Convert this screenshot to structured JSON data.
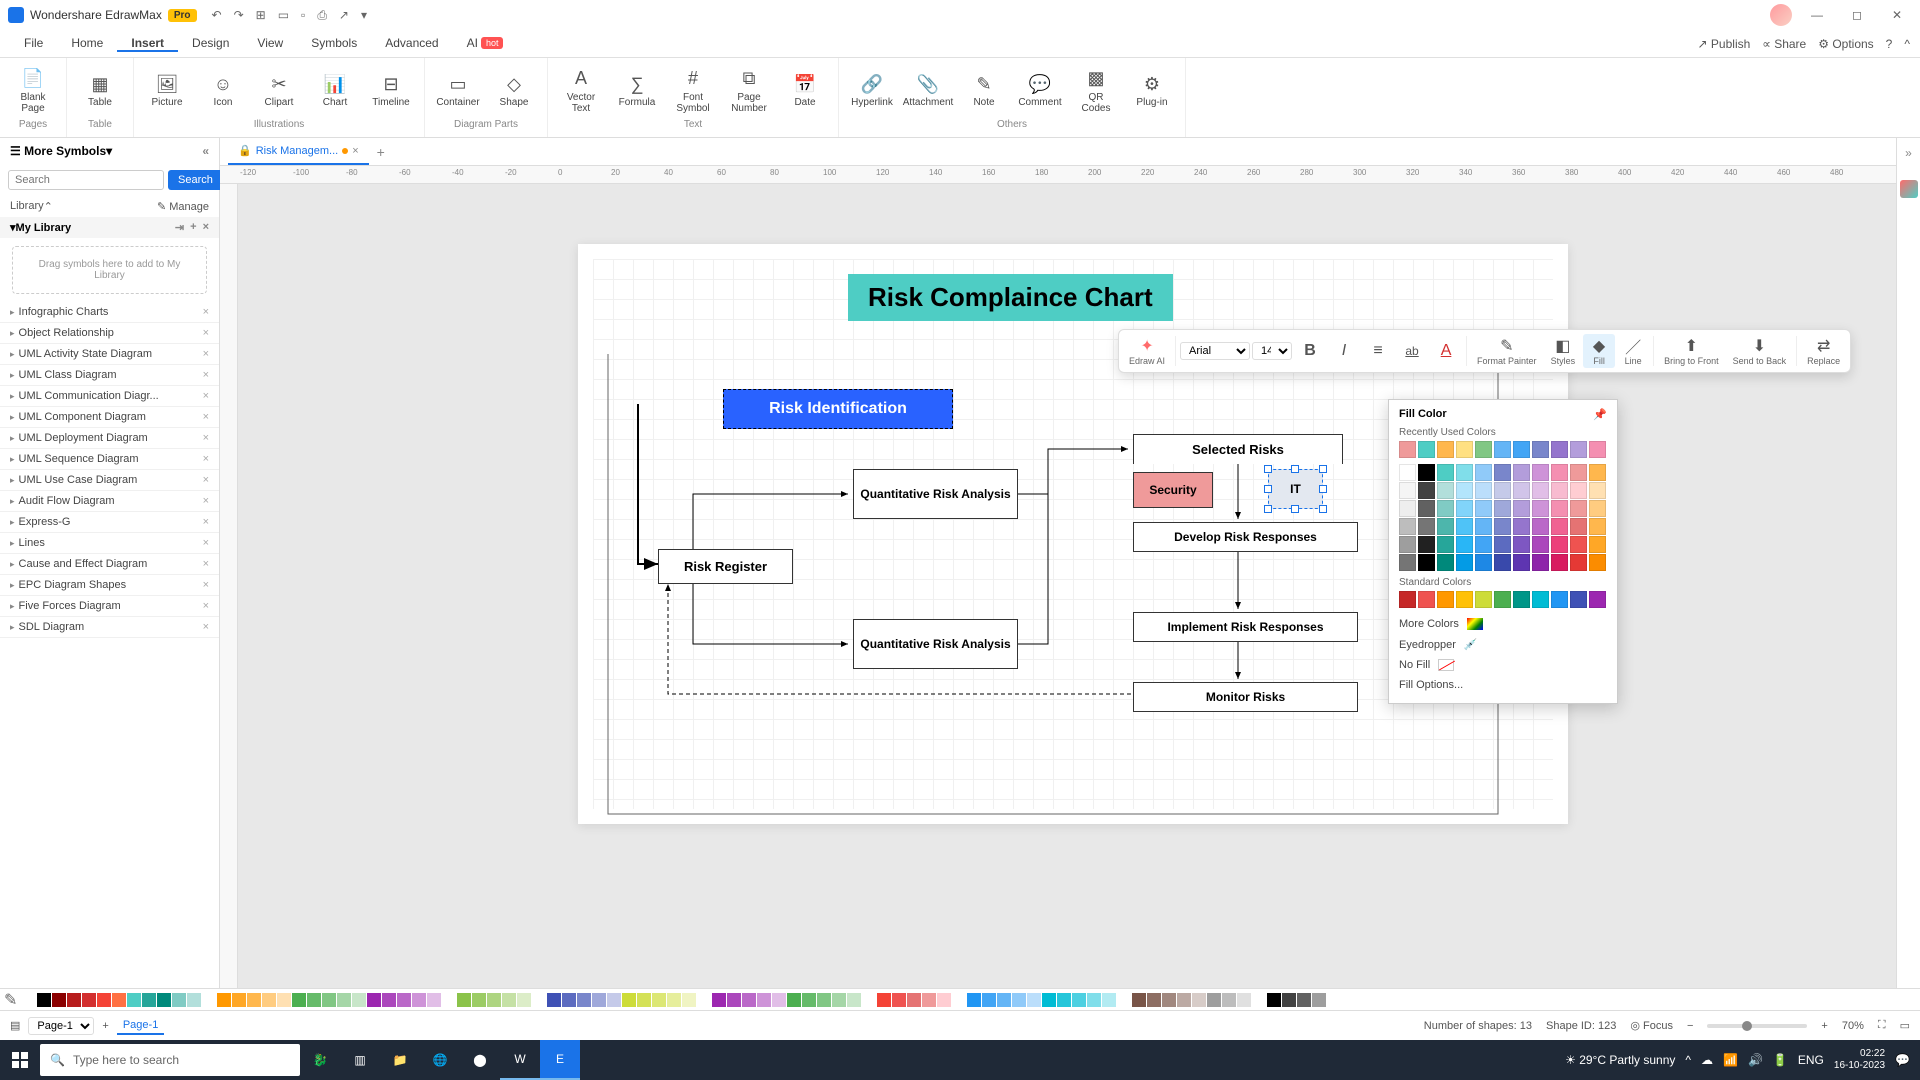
{
  "titlebar": {
    "app_name": "Wondershare EdrawMax",
    "pro_badge": "Pro"
  },
  "menubar": {
    "tabs": [
      "File",
      "Home",
      "Insert",
      "Design",
      "View",
      "Symbols",
      "Advanced",
      "AI"
    ],
    "active": "Insert",
    "ai_hot": "hot",
    "right": {
      "publish": "Publish",
      "share": "Share",
      "options": "Options"
    }
  },
  "ribbon": {
    "groups": [
      {
        "label": "Pages",
        "items": [
          {
            "label": "Blank\nPage",
            "icon": "📄"
          }
        ]
      },
      {
        "label": "Table",
        "items": [
          {
            "label": "Table",
            "icon": "▦"
          }
        ]
      },
      {
        "label": "Illustrations",
        "items": [
          {
            "label": "Picture",
            "icon": "🖼"
          },
          {
            "label": "Icon",
            "icon": "☺"
          },
          {
            "label": "Clipart",
            "icon": "✂"
          },
          {
            "label": "Chart",
            "icon": "📊"
          },
          {
            "label": "Timeline",
            "icon": "⊟"
          }
        ]
      },
      {
        "label": "Diagram Parts",
        "items": [
          {
            "label": "Container",
            "icon": "▭"
          },
          {
            "label": "Shape",
            "icon": "◇"
          }
        ]
      },
      {
        "label": "Text",
        "items": [
          {
            "label": "Vector\nText",
            "icon": "A"
          },
          {
            "label": "Formula",
            "icon": "∑"
          },
          {
            "label": "Font\nSymbol",
            "icon": "#"
          },
          {
            "label": "Page\nNumber",
            "icon": "⧉"
          },
          {
            "label": "Date",
            "icon": "📅"
          }
        ]
      },
      {
        "label": "Others",
        "items": [
          {
            "label": "Hyperlink",
            "icon": "🔗"
          },
          {
            "label": "Attachment",
            "icon": "📎"
          },
          {
            "label": "Note",
            "icon": "✎"
          },
          {
            "label": "Comment",
            "icon": "💬"
          },
          {
            "label": "QR\nCodes",
            "icon": "▩"
          },
          {
            "label": "Plug-in",
            "icon": "⚙"
          }
        ]
      }
    ]
  },
  "sidebar": {
    "title": "More Symbols",
    "search_placeholder": "Search",
    "search_btn": "Search",
    "library_label": "Library",
    "manage_label": "Manage",
    "mylibrary": "My Library",
    "dropzone": "Drag symbols here to add to My Library",
    "categories": [
      "Infographic Charts",
      "Object Relationship",
      "UML Activity State Diagram",
      "UML Class Diagram",
      "UML Communication Diagr...",
      "UML Component Diagram",
      "UML Deployment Diagram",
      "UML Sequence Diagram",
      "UML Use Case Diagram",
      "Audit Flow Diagram",
      "Express-G",
      "Lines",
      "Cause and Effect Diagram",
      "EPC Diagram Shapes",
      "Five Forces Diagram",
      "SDL Diagram"
    ]
  },
  "doc_tabs": {
    "active": "Risk Managem..."
  },
  "ruler_marks": [
    "-120",
    "-100",
    "-80",
    "-60",
    "-40",
    "-20",
    "0",
    "20",
    "40",
    "60",
    "80",
    "100",
    "120",
    "140",
    "160",
    "180",
    "200",
    "220",
    "240",
    "260",
    "280",
    "300",
    "320",
    "340",
    "360",
    "380",
    "400",
    "420",
    "440",
    "460",
    "480"
  ],
  "diagram": {
    "title": "Risk Complaince Chart",
    "risk_identification": "Risk Identification",
    "risk_register": "Risk Register",
    "qra1": "Quantitative Risk Analysis",
    "qra2": "Quantitative Risk Analysis",
    "selected_risks": "Selected Risks",
    "security": "Security",
    "it": "IT",
    "develop": "Develop Risk Responses",
    "implement": "Implement Risk Responses",
    "monitor": "Monitor Risks"
  },
  "float_toolbar": {
    "font_name": "Arial",
    "font_size": "14",
    "items": [
      {
        "label": "Edraw AI",
        "icon": "✦"
      },
      {
        "label": "",
        "icon": "B",
        "name": "bold"
      },
      {
        "label": "",
        "icon": "I",
        "name": "italic"
      },
      {
        "label": "",
        "icon": "≡",
        "name": "align"
      },
      {
        "label": "",
        "icon": "ab",
        "name": "strike"
      },
      {
        "label": "",
        "icon": "A",
        "name": "fontcolor"
      },
      {
        "label": "Format\nPainter",
        "icon": "✎"
      },
      {
        "label": "Styles",
        "icon": "◧"
      },
      {
        "label": "Fill",
        "icon": "◆",
        "highlighted": true
      },
      {
        "label": "Line",
        "icon": "／"
      },
      {
        "label": "Bring to\nFront",
        "icon": "⬆"
      },
      {
        "label": "Send to\nBack",
        "icon": "⬇"
      },
      {
        "label": "Replace",
        "icon": "⇄"
      }
    ]
  },
  "fill_popup": {
    "title": "Fill Color",
    "recent_label": "Recently Used Colors",
    "recent": [
      "#ef9a9a",
      "#4ecdc4",
      "#ffb74d",
      "#ffe082",
      "#81c784",
      "#64b5f6",
      "#42a5f5",
      "#7986cb",
      "#9575cd",
      "#b39ddb",
      "#f48fb1"
    ],
    "theme_rows": [
      [
        "#ffffff",
        "#000000",
        "#4ecdc4",
        "#80deea",
        "#90caf9",
        "#7986cb",
        "#b39ddb",
        "#ce93d8",
        "#f48fb1",
        "#ef9a9a",
        "#ffb74d"
      ],
      [
        "#f5f5f5",
        "#424242",
        "#b2dfdb",
        "#b3e5fc",
        "#bbdefb",
        "#c5cae9",
        "#d1c4e9",
        "#e1bee7",
        "#f8bbd0",
        "#ffcdd2",
        "#ffe0b2"
      ],
      [
        "#eeeeee",
        "#616161",
        "#80cbc4",
        "#81d4fa",
        "#90caf9",
        "#9fa8da",
        "#b39ddb",
        "#ce93d8",
        "#f48fb1",
        "#ef9a9a",
        "#ffcc80"
      ],
      [
        "#bdbdbd",
        "#757575",
        "#4db6ac",
        "#4fc3f7",
        "#64b5f6",
        "#7986cb",
        "#9575cd",
        "#ba68c8",
        "#f06292",
        "#e57373",
        "#ffb74d"
      ],
      [
        "#9e9e9e",
        "#212121",
        "#26a69a",
        "#29b6f6",
        "#42a5f5",
        "#5c6bc0",
        "#7e57c2",
        "#ab47bc",
        "#ec407a",
        "#ef5350",
        "#ffa726"
      ],
      [
        "#757575",
        "#000000",
        "#00897b",
        "#039be5",
        "#1e88e5",
        "#3949ab",
        "#5e35b1",
        "#8e24aa",
        "#d81b60",
        "#e53935",
        "#fb8c00"
      ]
    ],
    "standard_label": "Standard Colors",
    "standard": [
      "#c62828",
      "#ef5350",
      "#ff9800",
      "#ffc107",
      "#cddc39",
      "#4caf50",
      "#009688",
      "#00bcd4",
      "#2196f3",
      "#3f51b5",
      "#9c27b0"
    ],
    "more_colors": "More Colors",
    "eyedropper": "Eyedropper",
    "no_fill": "No Fill",
    "fill_options": "Fill Options..."
  },
  "colorbar": [
    "#ffffff",
    "#000000",
    "#8b0000",
    "#b71c1c",
    "#d32f2f",
    "#f44336",
    "#ff7043",
    "#4ecdc4",
    "#26a69a",
    "#00897b",
    "#80cbc4",
    "#b2dfdb",
    "#ffffff",
    "#ff9800",
    "#ffa726",
    "#ffb74d",
    "#ffcc80",
    "#ffe0b2",
    "#4caf50",
    "#66bb6a",
    "#81c784",
    "#a5d6a7",
    "#c8e6c9",
    "#9c27b0",
    "#ab47bc",
    "#ba68c8",
    "#ce93d8",
    "#e1bee7",
    "#ffffff",
    "#8bc34a",
    "#9ccc65",
    "#aed581",
    "#c5e1a5",
    "#dcedc8",
    "#ffffff",
    "#3f51b5",
    "#5c6bc0",
    "#7986cb",
    "#9fa8da",
    "#c5cae9",
    "#cddc39",
    "#d4e157",
    "#dce775",
    "#e6ee9c",
    "#f0f4c3",
    "#ffffff",
    "#9c27b0",
    "#ab47bc",
    "#ba68c8",
    "#ce93d8",
    "#e1bee7",
    "#4caf50",
    "#66bb6a",
    "#81c784",
    "#a5d6a7",
    "#c8e6c9",
    "#ffffff",
    "#f44336",
    "#ef5350",
    "#e57373",
    "#ef9a9a",
    "#ffcdd2",
    "#ffffff",
    "#2196f3",
    "#42a5f5",
    "#64b5f6",
    "#90caf9",
    "#bbdefb",
    "#00bcd4",
    "#26c6da",
    "#4dd0e1",
    "#80deea",
    "#b2ebf2",
    "#ffffff",
    "#795548",
    "#8d6e63",
    "#a1887f",
    "#bcaaa4",
    "#d7ccc8",
    "#9e9e9e",
    "#bdbdbd",
    "#e0e0e0",
    "#ffffff",
    "#000000",
    "#424242",
    "#616161",
    "#9e9e9e",
    "#ffffff"
  ],
  "statusbar": {
    "page_select": "Page-1",
    "page_tab": "Page-1",
    "shapes": "Number of shapes: 13",
    "shape_id": "Shape ID: 123",
    "focus": "Focus",
    "zoom": "70%"
  },
  "taskbar": {
    "search_placeholder": "Type here to search",
    "weather": "29°C  Partly sunny",
    "lang": "ENG",
    "time": "02:22",
    "date": "16-10-2023"
  }
}
